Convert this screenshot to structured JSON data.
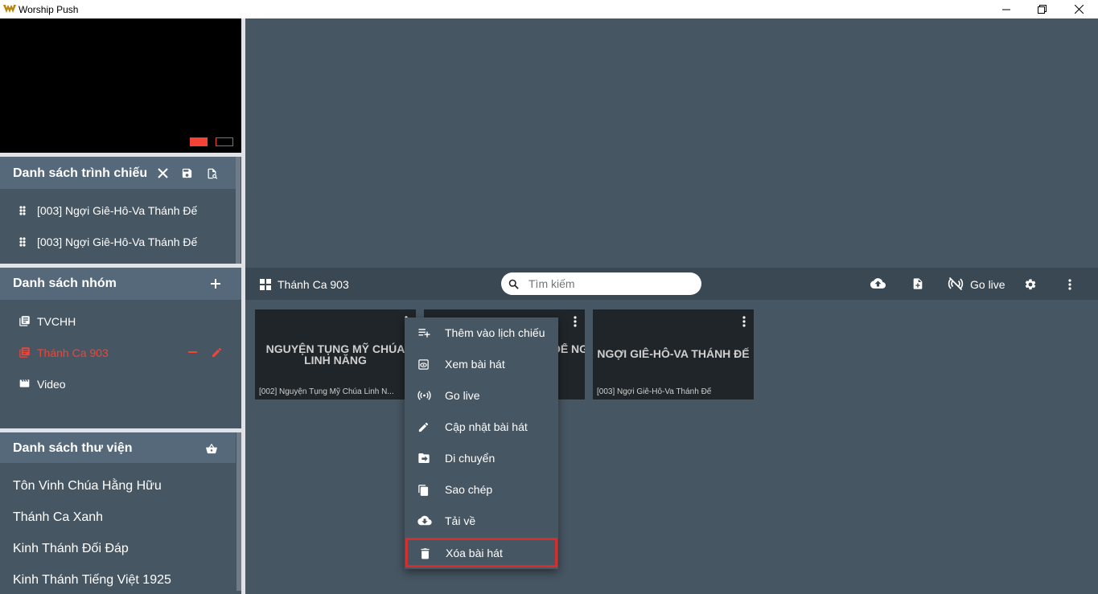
{
  "window": {
    "title": "Worship Push"
  },
  "playlist": {
    "title": "Danh sách trình chiếu",
    "items": [
      {
        "label": "[003] Ngợi Giê-Hô-Va Thánh Đế"
      },
      {
        "label": "[003] Ngợi Giê-Hô-Va Thánh Đế"
      }
    ]
  },
  "groups": {
    "title": "Danh sách nhóm",
    "items": [
      {
        "label": "TVCHH",
        "active": false
      },
      {
        "label": "Thánh Ca 903",
        "active": true
      },
      {
        "label": "Video",
        "active": false
      }
    ]
  },
  "library": {
    "title": "Danh sách thư viện",
    "items": [
      {
        "label": "Tôn Vinh Chúa Hằng Hữu"
      },
      {
        "label": "Thánh Ca Xanh"
      },
      {
        "label": "Kinh Thánh Đối Đáp"
      },
      {
        "label": "Kinh Thánh Tiếng Việt 1925"
      }
    ]
  },
  "toolbar": {
    "category": "Thánh Ca 903",
    "search_placeholder": "Tìm kiếm",
    "go_live": "Go live"
  },
  "songs": [
    {
      "title_line1": "NGUYỆN TỤNG MỸ CHÚA",
      "title_line2": "LINH NĂNG",
      "caption": "[002] Nguyện Tụng Mỹ Chúa Linh N..."
    },
    {
      "title_line1": "GỢI GIÊ-HÔ-VA THÁNH ĐẾ NGỰ",
      "title_line2": "",
      "caption": ""
    },
    {
      "title_line1": "NGỢI GIÊ-HÔ-VA THÁNH ĐẾ",
      "title_line2": "",
      "caption": "[003] Ngợi Giê-Hô-Va Thánh Đế"
    }
  ],
  "context_menu": {
    "items": [
      {
        "label": "Thêm vào lịch chiếu",
        "icon": "playlist-add-icon"
      },
      {
        "label": "Xem bài hát",
        "icon": "preview-icon"
      },
      {
        "label": "Go live",
        "icon": "broadcast-icon"
      },
      {
        "label": "Cập nhật bài hát",
        "icon": "edit-icon"
      },
      {
        "label": "Di chuyển",
        "icon": "move-folder-icon"
      },
      {
        "label": "Sao chép",
        "icon": "copy-icon"
      },
      {
        "label": "Tải về",
        "icon": "cloud-download-icon"
      },
      {
        "label": "Xóa bài hát",
        "icon": "trash-icon"
      }
    ],
    "highlighted_index": 7
  },
  "colors": {
    "panel": "#475663",
    "panel_header": "#55697b",
    "toolbar": "#3a4853",
    "accent_red": "#f44336",
    "highlight_border": "#d32f2f"
  }
}
